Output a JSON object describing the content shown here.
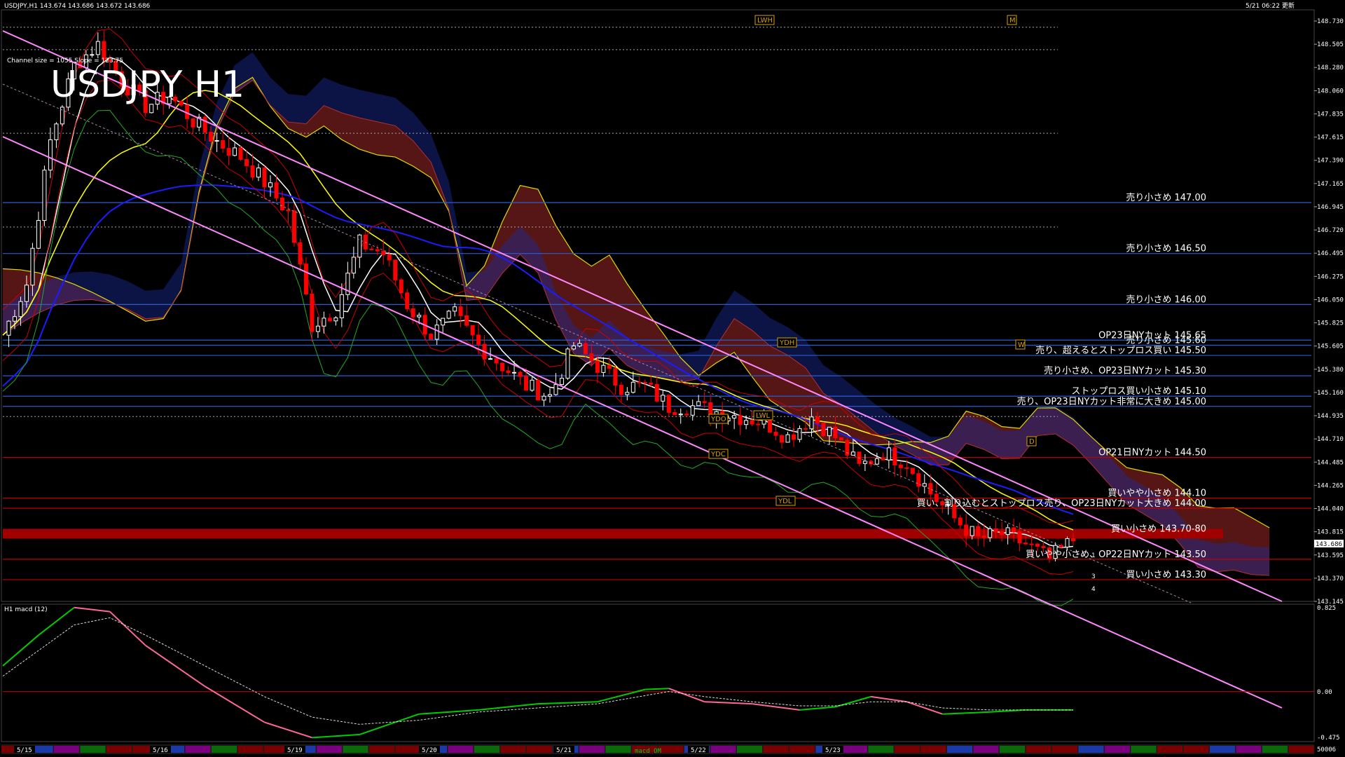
{
  "window": {
    "header_left": "USDJPY,H1  143.674 143.686 143.672 143.686",
    "header_right": "5/21 06:22 更新",
    "title_overlay": "USDJPY H1",
    "channel_info": "Channel size = 1055 Slope = 123.75",
    "indicator_title": "H1  macd (12)"
  },
  "colors": {
    "background": "#000000",
    "bull_candle": "#ffffff",
    "bear_candle": "#ff0000",
    "ma_white": "#ffffff",
    "ma_yellow": "#ffff00",
    "ma_blue": "#1c1cff",
    "channel": "#ff88ff",
    "cloud_blue": "#1a2a9a",
    "cloud_red": "#c03030",
    "level_blue": "#2a5cd0",
    "level_red": "#c00000",
    "macd_green": "#00cc00",
    "macd_pink": "#ff6699"
  },
  "price_axis": {
    "ticks": [
      "148.730",
      "148.505",
      "148.280",
      "148.060",
      "147.835",
      "147.615",
      "147.390",
      "147.165",
      "146.945",
      "146.720",
      "146.495",
      "146.275",
      "146.050",
      "145.825",
      "145.605",
      "145.380",
      "145.160",
      "144.935",
      "144.710",
      "144.485",
      "144.265",
      "144.040",
      "143.815",
      "143.595",
      "143.370",
      "143.145"
    ],
    "current_price": "143.686"
  },
  "macd_axis": {
    "ticks": [
      "0.825",
      "0.00",
      "-0.475"
    ],
    "bottom_label": "50006"
  },
  "date_axis": {
    "labels": [
      "5/15",
      "5/16",
      "5/19",
      "5/20",
      "5/21",
      "5/22",
      "5/23"
    ],
    "center_tag": "macd OM"
  },
  "levels": [
    {
      "text": "売り小さめ 147.00",
      "price": 147.0,
      "color": "#2a5cd0"
    },
    {
      "text": "売り小さめ 146.50",
      "price": 146.5,
      "color": "#2a5cd0"
    },
    {
      "text": "売り小さめ 146.00",
      "price": 146.0,
      "color": "#2a5cd0"
    },
    {
      "text": "OP23日NYカット 145.65",
      "price": 145.65,
      "color": "#2a5cd0"
    },
    {
      "text": "売り小さめ 145.60",
      "price": 145.6,
      "color": "#2a5cd0"
    },
    {
      "text": "売り、超えるとストップロス買い 145.50",
      "price": 145.5,
      "color": "#2a5cd0"
    },
    {
      "text": "売り小さめ、OP23日NYカット 145.30",
      "price": 145.3,
      "color": "#2a5cd0"
    },
    {
      "text": "ストップロス買い小さめ 145.10",
      "price": 145.1,
      "color": "#2a5cd0"
    },
    {
      "text": "売り、OP23日NYカット非常に大きめ 145.00",
      "price": 145.0,
      "color": "#2a5cd0"
    },
    {
      "text": "OP21日NYカット 144.50",
      "price": 144.5,
      "color": "#c00000"
    },
    {
      "text": "買いやや小さめ 144.10",
      "price": 144.1,
      "color": "#c00000"
    },
    {
      "text": "買い、割り込むとストップロス売り、OP23日NYカット大きめ 144.00",
      "price": 144.0,
      "color": "#c00000"
    },
    {
      "text": "買い小さめ 143.70-80",
      "price": 143.75,
      "color": "#c00000"
    },
    {
      "text": "買いやや小さめ、OP22日NYカット 143.50",
      "price": 143.5,
      "color": "#c00000"
    },
    {
      "text": "買い小さめ 143.30",
      "price": 143.3,
      "color": "#c00000"
    }
  ],
  "markers": [
    {
      "text": "LWH"
    },
    {
      "text": "M"
    },
    {
      "text": "YDH"
    },
    {
      "text": "YDO"
    },
    {
      "text": "LWL"
    },
    {
      "text": "YDC"
    },
    {
      "text": "YDL"
    },
    {
      "text": "D"
    },
    {
      "text": "W"
    }
  ],
  "wave_labels": [
    "1",
    "3",
    "4"
  ],
  "chart_data": {
    "type": "candlestick",
    "symbol": "USDJPY",
    "timeframe": "H1",
    "ylim": [
      143.1,
      148.85
    ],
    "bars_total": 215,
    "close_path": [
      [
        0,
        145.7
      ],
      [
        4,
        146.2
      ],
      [
        8,
        147.6
      ],
      [
        12,
        148.35
      ],
      [
        16,
        148.55
      ],
      [
        20,
        148.2
      ],
      [
        24,
        147.95
      ],
      [
        28,
        148.05
      ],
      [
        32,
        147.8
      ],
      [
        36,
        147.6
      ],
      [
        40,
        147.45
      ],
      [
        44,
        147.2
      ],
      [
        48,
        146.9
      ],
      [
        52,
        145.8
      ],
      [
        56,
        145.95
      ],
      [
        60,
        146.6
      ],
      [
        64,
        146.5
      ],
      [
        68,
        146.0
      ],
      [
        72,
        145.7
      ],
      [
        76,
        145.9
      ],
      [
        80,
        145.6
      ],
      [
        84,
        145.4
      ],
      [
        88,
        145.2
      ],
      [
        92,
        145.1
      ],
      [
        96,
        145.6
      ],
      [
        100,
        145.4
      ],
      [
        104,
        145.2
      ],
      [
        108,
        145.2
      ],
      [
        112,
        145.0
      ],
      [
        116,
        145.0
      ],
      [
        120,
        144.95
      ],
      [
        124,
        144.9
      ],
      [
        128,
        144.85
      ],
      [
        132,
        144.7
      ],
      [
        136,
        144.9
      ],
      [
        140,
        144.7
      ],
      [
        144,
        144.4
      ],
      [
        148,
        144.55
      ],
      [
        152,
        144.45
      ],
      [
        156,
        144.15
      ],
      [
        160,
        143.9
      ],
      [
        164,
        143.7
      ],
      [
        168,
        143.75
      ],
      [
        172,
        143.65
      ],
      [
        176,
        143.5
      ],
      [
        180,
        143.69
      ]
    ],
    "macd": {
      "ticks": [
        0.825,
        0.0,
        -0.475
      ],
      "main": [
        [
          0,
          0.25
        ],
        [
          6,
          0.55
        ],
        [
          12,
          0.82
        ],
        [
          18,
          0.78
        ],
        [
          24,
          0.45
        ],
        [
          34,
          0.05
        ],
        [
          44,
          -0.3
        ],
        [
          52,
          -0.45
        ],
        [
          60,
          -0.42
        ],
        [
          70,
          -0.22
        ],
        [
          80,
          -0.18
        ],
        [
          90,
          -0.12
        ],
        [
          100,
          -0.1
        ],
        [
          108,
          0.02
        ],
        [
          112,
          0.03
        ],
        [
          118,
          -0.1
        ],
        [
          126,
          -0.12
        ],
        [
          134,
          -0.18
        ],
        [
          140,
          -0.15
        ],
        [
          146,
          -0.05
        ],
        [
          152,
          -0.1
        ],
        [
          158,
          -0.22
        ],
        [
          166,
          -0.2
        ],
        [
          172,
          -0.18
        ],
        [
          180,
          -0.18
        ]
      ],
      "signal": [
        [
          0,
          0.15
        ],
        [
          6,
          0.4
        ],
        [
          12,
          0.65
        ],
        [
          18,
          0.72
        ],
        [
          24,
          0.55
        ],
        [
          34,
          0.25
        ],
        [
          44,
          -0.05
        ],
        [
          52,
          -0.25
        ],
        [
          60,
          -0.32
        ],
        [
          70,
          -0.28
        ],
        [
          80,
          -0.2
        ],
        [
          90,
          -0.16
        ],
        [
          100,
          -0.12
        ],
        [
          108,
          -0.04
        ],
        [
          112,
          0.0
        ],
        [
          118,
          -0.05
        ],
        [
          126,
          -0.1
        ],
        [
          134,
          -0.14
        ],
        [
          140,
          -0.14
        ],
        [
          146,
          -0.1
        ],
        [
          152,
          -0.1
        ],
        [
          158,
          -0.16
        ],
        [
          166,
          -0.18
        ],
        [
          172,
          -0.18
        ],
        [
          180,
          -0.18
        ]
      ]
    }
  }
}
